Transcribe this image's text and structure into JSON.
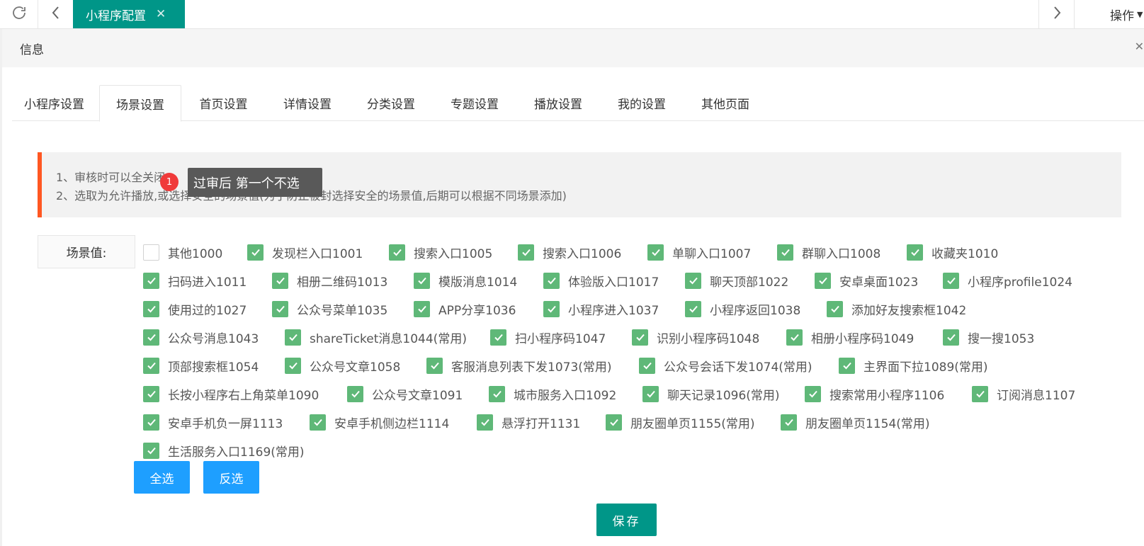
{
  "topbar": {
    "tab_label": "小程序配置",
    "ops_label": "操作"
  },
  "info": {
    "title": "信息"
  },
  "tabs": [
    "小程序设置",
    "场景设置",
    "首页设置",
    "详情设置",
    "分类设置",
    "专题设置",
    "播放设置",
    "我的设置",
    "其他页面"
  ],
  "active_tab": "场景设置",
  "notice": {
    "line1": "1、审核时可以全关闭",
    "line2": "2、选取为允许播放,或选择安全的场景值(为了防止被封选择安全的场景值,后期可以根据不同场景添加)"
  },
  "tooltip": {
    "text": "过审后 第一个不选",
    "badge": "1"
  },
  "scene": {
    "label": "场景值:",
    "options": [
      {
        "label": "其他1000",
        "checked": false
      },
      {
        "label": "发现栏入口1001",
        "checked": true
      },
      {
        "label": "搜索入口1005",
        "checked": true
      },
      {
        "label": "搜索入口1006",
        "checked": true
      },
      {
        "label": "单聊入口1007",
        "checked": true
      },
      {
        "label": "群聊入口1008",
        "checked": true
      },
      {
        "label": "收藏夹1010",
        "checked": true
      },
      {
        "label": "扫码进入1011",
        "checked": true
      },
      {
        "label": "相册二维码1013",
        "checked": true
      },
      {
        "label": "模版消息1014",
        "checked": true
      },
      {
        "label": "体验版入口1017",
        "checked": true
      },
      {
        "label": "聊天顶部1022",
        "checked": true
      },
      {
        "label": "安卓桌面1023",
        "checked": true
      },
      {
        "label": "小程序profile1024",
        "checked": true
      },
      {
        "label": "使用过的1027",
        "checked": true
      },
      {
        "label": "公众号菜单1035",
        "checked": true
      },
      {
        "label": "APP分享1036",
        "checked": true
      },
      {
        "label": "小程序进入1037",
        "checked": true
      },
      {
        "label": "小程序返回1038",
        "checked": true
      },
      {
        "label": "添加好友搜索框1042",
        "checked": true
      },
      {
        "label": "公众号消息1043",
        "checked": true
      },
      {
        "label": "shareTicket消息1044(常用)",
        "checked": true
      },
      {
        "label": "扫小程序码1047",
        "checked": true
      },
      {
        "label": "识别小程序码1048",
        "checked": true
      },
      {
        "label": "相册小程序码1049",
        "checked": true
      },
      {
        "label": "搜一搜1053",
        "checked": true
      },
      {
        "label": "顶部搜索框1054",
        "checked": true
      },
      {
        "label": "公众号文章1058",
        "checked": true
      },
      {
        "label": "客服消息列表下发1073(常用)",
        "checked": true
      },
      {
        "label": "公众号会话下发1074(常用)",
        "checked": true
      },
      {
        "label": "主界面下拉1089(常用)",
        "checked": true
      },
      {
        "label": "长按小程序右上角菜单1090",
        "checked": true
      },
      {
        "label": "公众号文章1091",
        "checked": true
      },
      {
        "label": "城市服务入口1092",
        "checked": true
      },
      {
        "label": "聊天记录1096(常用)",
        "checked": true
      },
      {
        "label": "搜索常用小程序1106",
        "checked": true
      },
      {
        "label": "订阅消息1107",
        "checked": true
      },
      {
        "label": "安卓手机负一屏1113",
        "checked": true
      },
      {
        "label": "安卓手机侧边栏1114",
        "checked": true
      },
      {
        "label": "悬浮打开1131",
        "checked": true
      },
      {
        "label": "朋友圈单页1155(常用)",
        "checked": true
      },
      {
        "label": "朋友圈单页1154(常用)",
        "checked": true
      },
      {
        "label": "生活服务入口1169(常用)",
        "checked": true
      }
    ]
  },
  "buttons": {
    "select_all": "全选",
    "invert": "反选",
    "save": "保存"
  },
  "colors": {
    "primary": "#009688",
    "checked": "#5fb878",
    "accent": "#ff5722",
    "button": "#1e9fff"
  }
}
